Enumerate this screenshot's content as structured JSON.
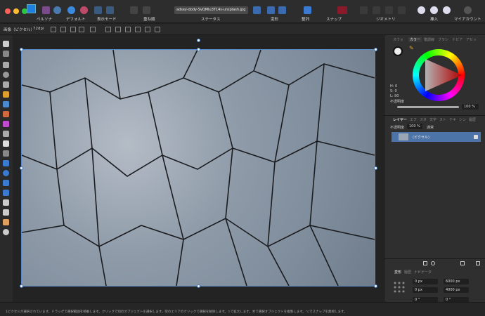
{
  "toolbar": {
    "persona": "ペルソナ",
    "default": "デフォルト",
    "view_mode": "表示モード",
    "order": "重ね順",
    "document_name": "adsey-dody-SvQMIu3T14s-unsplash.jpg",
    "status": "ステータス",
    "transform": "変形",
    "align": "整列",
    "snap": "スナップ",
    "geometry": "ジオメトリ",
    "insert": "挿入",
    "account": "マイアカウント"
  },
  "context": {
    "size_label": "画像（ピクセル）",
    "dpi": "72dpi"
  },
  "color_panel": {
    "tabs": [
      "スウォ",
      "カラー",
      "階調線",
      "ブラシ",
      "ナビア",
      "アセッ"
    ],
    "active": "カラー",
    "h": "H: 0",
    "s": "S: 0",
    "l": "L: 90",
    "opacity_label": "不透明度",
    "opacity": "100 %",
    "opacity_value": 1.0,
    "hue_color": "#ff0000"
  },
  "layers_panel": {
    "tabs": [
      "レイヤー",
      "エフ",
      "スタ",
      "文字",
      "スト",
      "テキ",
      "シン",
      "履歴"
    ],
    "opacity_label": "不透明度",
    "opacity": "100 %",
    "blend": "通常",
    "layers": [
      {
        "name": "(ピクセル)",
        "selected": true
      }
    ]
  },
  "transform_panel": {
    "tabs": [
      "変形",
      "履歴",
      "ナビゲータ"
    ],
    "x": "0 px",
    "y": "0 px",
    "w": "6000 px",
    "h": "4000 px",
    "rotation": "0 °",
    "shear": "0 °"
  },
  "status_text": "1ピクセルが選択されています。ドラッグで選択範囲を移動します。クリックで別のオブジェクトを選択します。空のエリアのクリックで選択を解除します。⇧で拡大します。⌘で選択オブジェクトを複製します。⌥でスナップを無視します。"
}
